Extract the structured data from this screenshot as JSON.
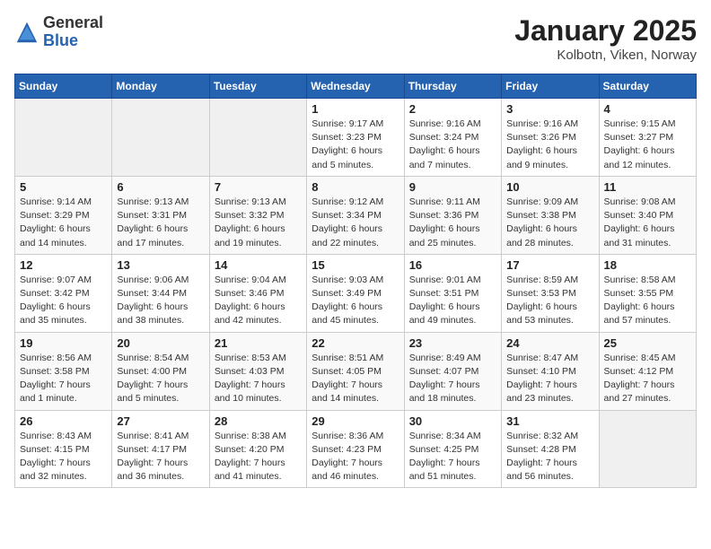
{
  "header": {
    "logo_line1": "General",
    "logo_line2": "Blue",
    "title": "January 2025",
    "subtitle": "Kolbotn, Viken, Norway"
  },
  "days_of_week": [
    "Sunday",
    "Monday",
    "Tuesday",
    "Wednesday",
    "Thursday",
    "Friday",
    "Saturday"
  ],
  "weeks": [
    [
      {
        "day": "",
        "info": ""
      },
      {
        "day": "",
        "info": ""
      },
      {
        "day": "",
        "info": ""
      },
      {
        "day": "1",
        "info": "Sunrise: 9:17 AM\nSunset: 3:23 PM\nDaylight: 6 hours\nand 5 minutes."
      },
      {
        "day": "2",
        "info": "Sunrise: 9:16 AM\nSunset: 3:24 PM\nDaylight: 6 hours\nand 7 minutes."
      },
      {
        "day": "3",
        "info": "Sunrise: 9:16 AM\nSunset: 3:26 PM\nDaylight: 6 hours\nand 9 minutes."
      },
      {
        "day": "4",
        "info": "Sunrise: 9:15 AM\nSunset: 3:27 PM\nDaylight: 6 hours\nand 12 minutes."
      }
    ],
    [
      {
        "day": "5",
        "info": "Sunrise: 9:14 AM\nSunset: 3:29 PM\nDaylight: 6 hours\nand 14 minutes."
      },
      {
        "day": "6",
        "info": "Sunrise: 9:13 AM\nSunset: 3:31 PM\nDaylight: 6 hours\nand 17 minutes."
      },
      {
        "day": "7",
        "info": "Sunrise: 9:13 AM\nSunset: 3:32 PM\nDaylight: 6 hours\nand 19 minutes."
      },
      {
        "day": "8",
        "info": "Sunrise: 9:12 AM\nSunset: 3:34 PM\nDaylight: 6 hours\nand 22 minutes."
      },
      {
        "day": "9",
        "info": "Sunrise: 9:11 AM\nSunset: 3:36 PM\nDaylight: 6 hours\nand 25 minutes."
      },
      {
        "day": "10",
        "info": "Sunrise: 9:09 AM\nSunset: 3:38 PM\nDaylight: 6 hours\nand 28 minutes."
      },
      {
        "day": "11",
        "info": "Sunrise: 9:08 AM\nSunset: 3:40 PM\nDaylight: 6 hours\nand 31 minutes."
      }
    ],
    [
      {
        "day": "12",
        "info": "Sunrise: 9:07 AM\nSunset: 3:42 PM\nDaylight: 6 hours\nand 35 minutes."
      },
      {
        "day": "13",
        "info": "Sunrise: 9:06 AM\nSunset: 3:44 PM\nDaylight: 6 hours\nand 38 minutes."
      },
      {
        "day": "14",
        "info": "Sunrise: 9:04 AM\nSunset: 3:46 PM\nDaylight: 6 hours\nand 42 minutes."
      },
      {
        "day": "15",
        "info": "Sunrise: 9:03 AM\nSunset: 3:49 PM\nDaylight: 6 hours\nand 45 minutes."
      },
      {
        "day": "16",
        "info": "Sunrise: 9:01 AM\nSunset: 3:51 PM\nDaylight: 6 hours\nand 49 minutes."
      },
      {
        "day": "17",
        "info": "Sunrise: 8:59 AM\nSunset: 3:53 PM\nDaylight: 6 hours\nand 53 minutes."
      },
      {
        "day": "18",
        "info": "Sunrise: 8:58 AM\nSunset: 3:55 PM\nDaylight: 6 hours\nand 57 minutes."
      }
    ],
    [
      {
        "day": "19",
        "info": "Sunrise: 8:56 AM\nSunset: 3:58 PM\nDaylight: 7 hours\nand 1 minute."
      },
      {
        "day": "20",
        "info": "Sunrise: 8:54 AM\nSunset: 4:00 PM\nDaylight: 7 hours\nand 5 minutes."
      },
      {
        "day": "21",
        "info": "Sunrise: 8:53 AM\nSunset: 4:03 PM\nDaylight: 7 hours\nand 10 minutes."
      },
      {
        "day": "22",
        "info": "Sunrise: 8:51 AM\nSunset: 4:05 PM\nDaylight: 7 hours\nand 14 minutes."
      },
      {
        "day": "23",
        "info": "Sunrise: 8:49 AM\nSunset: 4:07 PM\nDaylight: 7 hours\nand 18 minutes."
      },
      {
        "day": "24",
        "info": "Sunrise: 8:47 AM\nSunset: 4:10 PM\nDaylight: 7 hours\nand 23 minutes."
      },
      {
        "day": "25",
        "info": "Sunrise: 8:45 AM\nSunset: 4:12 PM\nDaylight: 7 hours\nand 27 minutes."
      }
    ],
    [
      {
        "day": "26",
        "info": "Sunrise: 8:43 AM\nSunset: 4:15 PM\nDaylight: 7 hours\nand 32 minutes."
      },
      {
        "day": "27",
        "info": "Sunrise: 8:41 AM\nSunset: 4:17 PM\nDaylight: 7 hours\nand 36 minutes."
      },
      {
        "day": "28",
        "info": "Sunrise: 8:38 AM\nSunset: 4:20 PM\nDaylight: 7 hours\nand 41 minutes."
      },
      {
        "day": "29",
        "info": "Sunrise: 8:36 AM\nSunset: 4:23 PM\nDaylight: 7 hours\nand 46 minutes."
      },
      {
        "day": "30",
        "info": "Sunrise: 8:34 AM\nSunset: 4:25 PM\nDaylight: 7 hours\nand 51 minutes."
      },
      {
        "day": "31",
        "info": "Sunrise: 8:32 AM\nSunset: 4:28 PM\nDaylight: 7 hours\nand 56 minutes."
      },
      {
        "day": "",
        "info": ""
      }
    ]
  ]
}
